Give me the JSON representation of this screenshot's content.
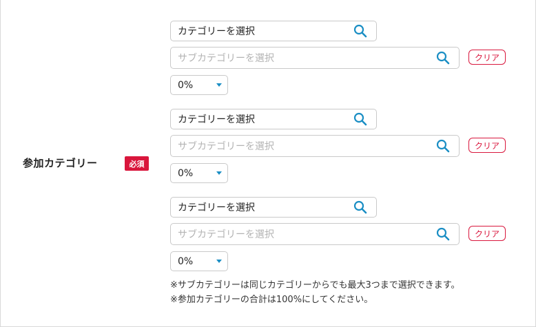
{
  "field": {
    "label": "参加カテゴリー",
    "required_badge": "必須"
  },
  "groups": [
    {
      "category_input": "カテゴリーを選択",
      "subcategory_placeholder": "サブカテゴリーを選択",
      "clear_label": "クリア",
      "percent": "0%"
    },
    {
      "category_input": "カテゴリーを選択",
      "subcategory_placeholder": "サブカテゴリーを選択",
      "clear_label": "クリア",
      "percent": "0%"
    },
    {
      "category_input": "カテゴリーを選択",
      "subcategory_placeholder": "サブカテゴリーを選択",
      "clear_label": "クリア",
      "percent": "0%"
    }
  ],
  "notes": [
    "※サブカテゴリーは同じカテゴリーからでも最大3つまで選択できます。",
    "※参加カテゴリーの合計は100%にしてください。"
  ],
  "icons": {
    "search": "search-icon",
    "dropdown": "chevron-down-icon"
  },
  "colors": {
    "accent": "#1a8ec4",
    "required": "#d9163c",
    "border": "#c9c9c9",
    "placeholder": "#b3b3b3"
  }
}
